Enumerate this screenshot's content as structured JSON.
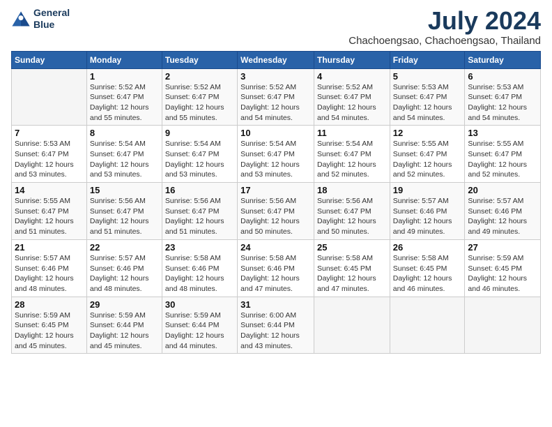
{
  "logo": {
    "line1": "General",
    "line2": "Blue"
  },
  "title": "July 2024",
  "location": "Chachoengsao, Chachoengsao, Thailand",
  "headers": [
    "Sunday",
    "Monday",
    "Tuesday",
    "Wednesday",
    "Thursday",
    "Friday",
    "Saturday"
  ],
  "weeks": [
    [
      {
        "day": "",
        "info": ""
      },
      {
        "day": "1",
        "info": "Sunrise: 5:52 AM\nSunset: 6:47 PM\nDaylight: 12 hours\nand 55 minutes."
      },
      {
        "day": "2",
        "info": "Sunrise: 5:52 AM\nSunset: 6:47 PM\nDaylight: 12 hours\nand 55 minutes."
      },
      {
        "day": "3",
        "info": "Sunrise: 5:52 AM\nSunset: 6:47 PM\nDaylight: 12 hours\nand 54 minutes."
      },
      {
        "day": "4",
        "info": "Sunrise: 5:52 AM\nSunset: 6:47 PM\nDaylight: 12 hours\nand 54 minutes."
      },
      {
        "day": "5",
        "info": "Sunrise: 5:53 AM\nSunset: 6:47 PM\nDaylight: 12 hours\nand 54 minutes."
      },
      {
        "day": "6",
        "info": "Sunrise: 5:53 AM\nSunset: 6:47 PM\nDaylight: 12 hours\nand 54 minutes."
      }
    ],
    [
      {
        "day": "7",
        "info": "Sunrise: 5:53 AM\nSunset: 6:47 PM\nDaylight: 12 hours\nand 53 minutes."
      },
      {
        "day": "8",
        "info": "Sunrise: 5:54 AM\nSunset: 6:47 PM\nDaylight: 12 hours\nand 53 minutes."
      },
      {
        "day": "9",
        "info": "Sunrise: 5:54 AM\nSunset: 6:47 PM\nDaylight: 12 hours\nand 53 minutes."
      },
      {
        "day": "10",
        "info": "Sunrise: 5:54 AM\nSunset: 6:47 PM\nDaylight: 12 hours\nand 53 minutes."
      },
      {
        "day": "11",
        "info": "Sunrise: 5:54 AM\nSunset: 6:47 PM\nDaylight: 12 hours\nand 52 minutes."
      },
      {
        "day": "12",
        "info": "Sunrise: 5:55 AM\nSunset: 6:47 PM\nDaylight: 12 hours\nand 52 minutes."
      },
      {
        "day": "13",
        "info": "Sunrise: 5:55 AM\nSunset: 6:47 PM\nDaylight: 12 hours\nand 52 minutes."
      }
    ],
    [
      {
        "day": "14",
        "info": "Sunrise: 5:55 AM\nSunset: 6:47 PM\nDaylight: 12 hours\nand 51 minutes."
      },
      {
        "day": "15",
        "info": "Sunrise: 5:56 AM\nSunset: 6:47 PM\nDaylight: 12 hours\nand 51 minutes."
      },
      {
        "day": "16",
        "info": "Sunrise: 5:56 AM\nSunset: 6:47 PM\nDaylight: 12 hours\nand 51 minutes."
      },
      {
        "day": "17",
        "info": "Sunrise: 5:56 AM\nSunset: 6:47 PM\nDaylight: 12 hours\nand 50 minutes."
      },
      {
        "day": "18",
        "info": "Sunrise: 5:56 AM\nSunset: 6:47 PM\nDaylight: 12 hours\nand 50 minutes."
      },
      {
        "day": "19",
        "info": "Sunrise: 5:57 AM\nSunset: 6:46 PM\nDaylight: 12 hours\nand 49 minutes."
      },
      {
        "day": "20",
        "info": "Sunrise: 5:57 AM\nSunset: 6:46 PM\nDaylight: 12 hours\nand 49 minutes."
      }
    ],
    [
      {
        "day": "21",
        "info": "Sunrise: 5:57 AM\nSunset: 6:46 PM\nDaylight: 12 hours\nand 48 minutes."
      },
      {
        "day": "22",
        "info": "Sunrise: 5:57 AM\nSunset: 6:46 PM\nDaylight: 12 hours\nand 48 minutes."
      },
      {
        "day": "23",
        "info": "Sunrise: 5:58 AM\nSunset: 6:46 PM\nDaylight: 12 hours\nand 48 minutes."
      },
      {
        "day": "24",
        "info": "Sunrise: 5:58 AM\nSunset: 6:46 PM\nDaylight: 12 hours\nand 47 minutes."
      },
      {
        "day": "25",
        "info": "Sunrise: 5:58 AM\nSunset: 6:45 PM\nDaylight: 12 hours\nand 47 minutes."
      },
      {
        "day": "26",
        "info": "Sunrise: 5:58 AM\nSunset: 6:45 PM\nDaylight: 12 hours\nand 46 minutes."
      },
      {
        "day": "27",
        "info": "Sunrise: 5:59 AM\nSunset: 6:45 PM\nDaylight: 12 hours\nand 46 minutes."
      }
    ],
    [
      {
        "day": "28",
        "info": "Sunrise: 5:59 AM\nSunset: 6:45 PM\nDaylight: 12 hours\nand 45 minutes."
      },
      {
        "day": "29",
        "info": "Sunrise: 5:59 AM\nSunset: 6:44 PM\nDaylight: 12 hours\nand 45 minutes."
      },
      {
        "day": "30",
        "info": "Sunrise: 5:59 AM\nSunset: 6:44 PM\nDaylight: 12 hours\nand 44 minutes."
      },
      {
        "day": "31",
        "info": "Sunrise: 6:00 AM\nSunset: 6:44 PM\nDaylight: 12 hours\nand 43 minutes."
      },
      {
        "day": "",
        "info": ""
      },
      {
        "day": "",
        "info": ""
      },
      {
        "day": "",
        "info": ""
      }
    ]
  ]
}
